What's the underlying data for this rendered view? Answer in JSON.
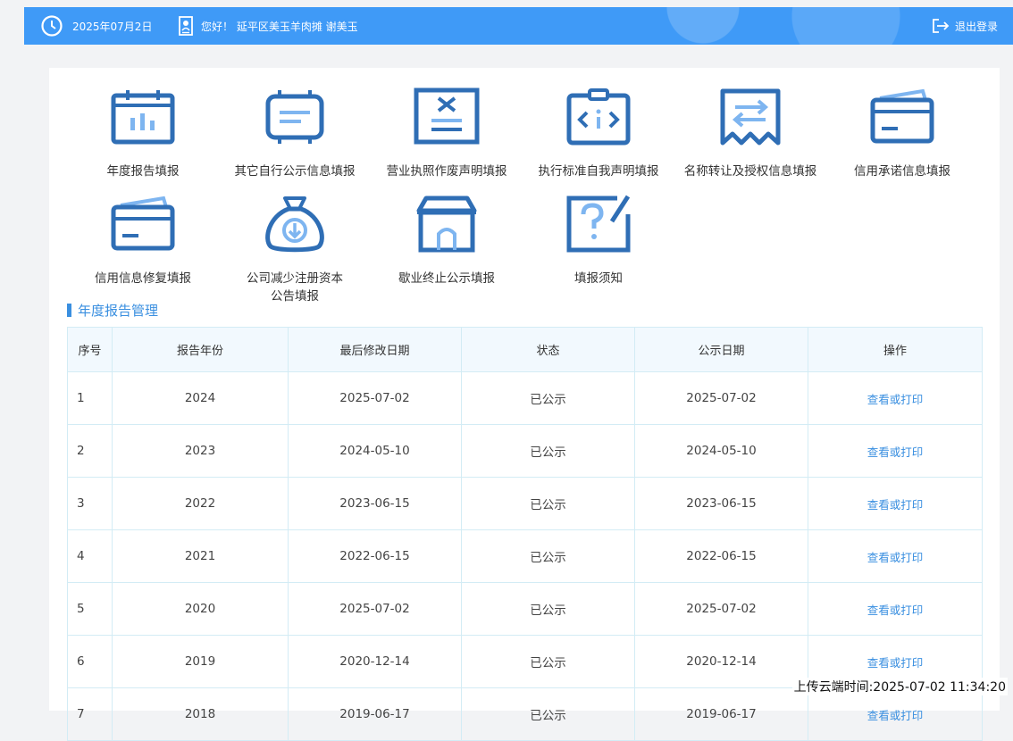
{
  "header": {
    "date": "2025年07月2日",
    "greeting": "您好！ 延平区美玉羊肉摊 谢美玉",
    "logout_label": "退出登录"
  },
  "menu": [
    {
      "label": "年度报告填报",
      "icon": "calendar-chart-icon"
    },
    {
      "label": "其它自行公示信息填报",
      "icon": "document-board-icon"
    },
    {
      "label": "营业执照作废声明填报",
      "icon": "cancel-document-icon"
    },
    {
      "label": "执行标准自我声明填报",
      "icon": "code-clipboard-icon"
    },
    {
      "label": "名称转让及授权信息填报",
      "icon": "transfer-receipt-icon"
    },
    {
      "label": "信用承诺信息填报",
      "icon": "credit-card-icon"
    },
    {
      "label": "信用信息修复填报",
      "icon": "credit-card-icon"
    },
    {
      "label": "公司减少注册资本公告填报",
      "label_line1": "公司减少注册资本",
      "label_line2": "公告填报",
      "icon": "money-bag-icon"
    },
    {
      "label": "歇业终止公示填报",
      "icon": "shop-icon"
    },
    {
      "label": "填报须知",
      "icon": "question-note-icon"
    }
  ],
  "section_title": "年度报告管理",
  "table": {
    "headers": [
      "序号",
      "报告年份",
      "最后修改日期",
      "状态",
      "公示日期",
      "操作"
    ],
    "rows": [
      {
        "no": "1",
        "year": "2024",
        "modified": "2025-07-02",
        "status": "已公示",
        "published": "2025-07-02",
        "action": "查看或打印"
      },
      {
        "no": "2",
        "year": "2023",
        "modified": "2024-05-10",
        "status": "已公示",
        "published": "2024-05-10",
        "action": "查看或打印"
      },
      {
        "no": "3",
        "year": "2022",
        "modified": "2023-06-15",
        "status": "已公示",
        "published": "2023-06-15",
        "action": "查看或打印"
      },
      {
        "no": "4",
        "year": "2021",
        "modified": "2022-06-15",
        "status": "已公示",
        "published": "2022-06-15",
        "action": "查看或打印"
      },
      {
        "no": "5",
        "year": "2020",
        "modified": "2025-07-02",
        "status": "已公示",
        "published": "2025-07-02",
        "action": "查看或打印"
      },
      {
        "no": "6",
        "year": "2019",
        "modified": "2020-12-14",
        "status": "已公示",
        "published": "2020-12-14",
        "action": "查看或打印"
      },
      {
        "no": "7",
        "year": "2018",
        "modified": "2019-06-17",
        "status": "已公示",
        "published": "2019-06-17",
        "action": "查看或打印"
      }
    ]
  },
  "footer": {
    "upload_time": "上传云端时间:2025-07-02 11:34:20"
  },
  "colors": {
    "header_bg": "#3f9af7",
    "icon_blue": "#2f6eb5",
    "icon_light": "#7eb5f0",
    "accent": "#3a8fe0"
  }
}
